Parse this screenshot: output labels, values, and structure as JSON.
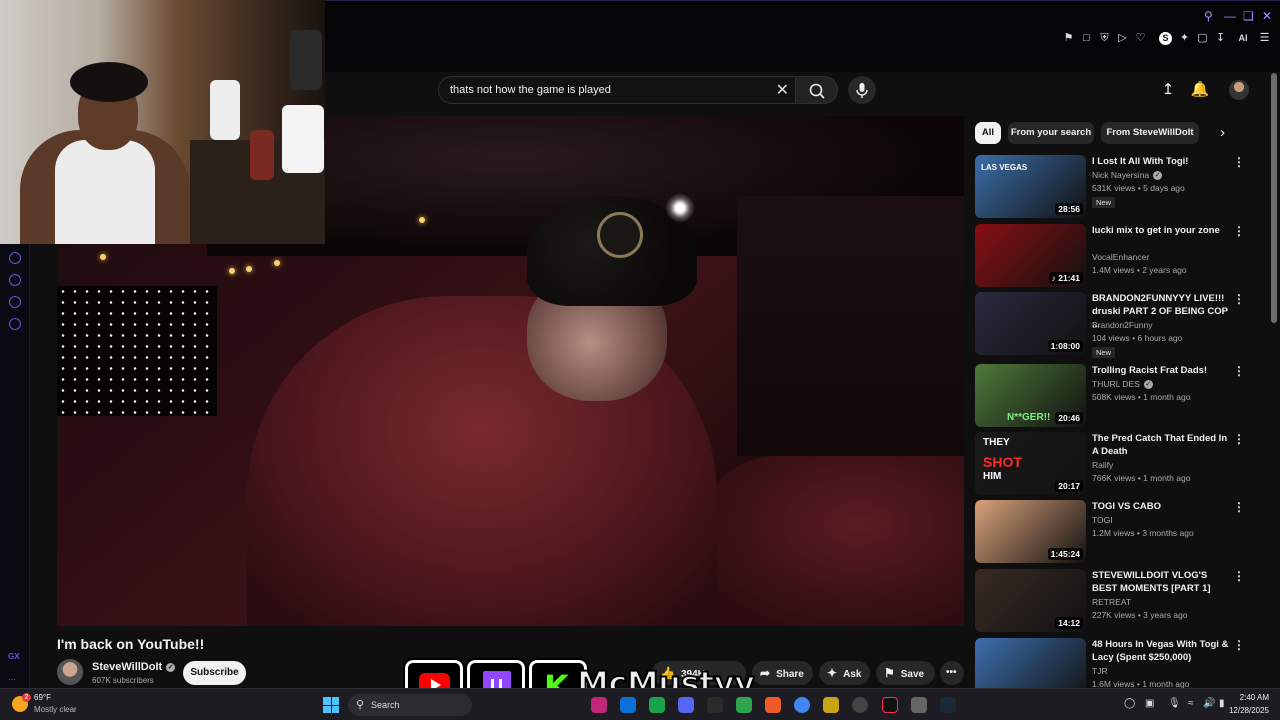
{
  "browser": {
    "gx_label": "GX",
    "gx_more": "...",
    "extension_ai_label": "AI",
    "extension_s_label": "S"
  },
  "youtube": {
    "search": {
      "value": "thats not how the game is played",
      "placeholder": "Search"
    },
    "video": {
      "title": "I'm back on YouTube!!",
      "channel": "SteveWillDoIt",
      "subscribers": "607K subscribers",
      "subscribe_label": "Subscribe",
      "likes": "394K",
      "share_label": "Share",
      "ask_label": "Ask",
      "save_label": "Save"
    },
    "chips": [
      "All",
      "From your search",
      "From SteveWillDoIt"
    ],
    "recommendations": [
      {
        "title": "I Lost It All With Togi!",
        "channel": "Nick Nayersina",
        "verified": true,
        "meta": "531K views • 5 days ago",
        "duration": "28:56",
        "badge": "New",
        "thumb_color": "#3b6ea8"
      },
      {
        "title": "lucki mix to get in your zone",
        "channel": "VocalEnhancer",
        "verified": false,
        "meta": "1.4M views • 2 years ago",
        "duration": "♪ 21:41",
        "badge": "",
        "thumb_color": "#8a0f12"
      },
      {
        "title": "BRANDON2FUNNYYY LIVE!!! druski PART 2 OF BEING COP ...",
        "channel": "Brandon2Funny",
        "verified": false,
        "meta": "104 views • 6 hours ago",
        "duration": "1:08:00",
        "badge": "New",
        "thumb_color": "#2a2a40"
      },
      {
        "title": "Trolling Racist Frat Dads!",
        "channel": "THURL DES",
        "verified": true,
        "meta": "508K views • 1 month ago",
        "duration": "20:46",
        "badge": "",
        "thumb_color": "#4f7a3a"
      },
      {
        "title": "The Pred Catch That Ended In A Death",
        "channel": "Ralify",
        "verified": false,
        "meta": "766K views • 1 month ago",
        "duration": "20:17",
        "badge": "",
        "thumb_color": "#1a1a1a"
      },
      {
        "title": "TOGI VS CABO",
        "channel": "TOGI",
        "verified": false,
        "meta": "1.2M views • 3 months ago",
        "duration": "1:45:24",
        "badge": "",
        "thumb_color": "#d9a27a"
      },
      {
        "title": "STEVEWILLDOIT VLOG'S BEST MOMENTS [PART 1]",
        "channel": "RETREAT",
        "verified": false,
        "meta": "227K views • 3 years ago",
        "duration": "14:12",
        "badge": "",
        "thumb_color": "#3a2a24"
      },
      {
        "title": "48 Hours In Vegas With Togi & Lacy (Spent $250,000)",
        "channel": "TJR",
        "verified": false,
        "meta": "1.6M views • 1 month ago",
        "duration": "",
        "badge": "",
        "thumb_color": "#3d6fb0"
      }
    ],
    "thumb_overlay_texts": {
      "vegas": "LAS VEGAS",
      "troll": "N**GER!!",
      "pred1": "THEY",
      "pred2": "SHOT",
      "pred3": "HIM"
    }
  },
  "banner": {
    "name": "McMustyy",
    "kick_letter": "K"
  },
  "taskbar": {
    "temperature": "69°F",
    "condition": "Mostly clear",
    "search_label": "Search",
    "time": "2:40 AM",
    "date": "12/28/2025",
    "weather_badge": "2"
  },
  "colors": {
    "accent": "#6d4fd8",
    "youtube_red": "#ff0000",
    "twitch": "#9146ff",
    "kick": "#53fc18"
  }
}
